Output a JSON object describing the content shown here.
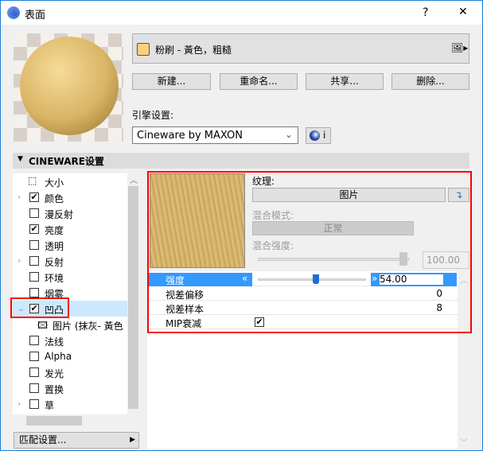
{
  "window": {
    "title": "表面",
    "help": "?",
    "close": "✕"
  },
  "material": {
    "name": "粉刷 - 黃色，粗糙",
    "swatch_color": "#fcd07f"
  },
  "buttons": {
    "new": "新建...",
    "rename": "重命名...",
    "share": "共享...",
    "delete": "删除..."
  },
  "engine": {
    "label": "引擎设置:",
    "value": "Cineware by MAXON",
    "info": "i"
  },
  "section": {
    "title": "CINEWARE设置"
  },
  "tree": [
    {
      "label": "大小",
      "type": "size",
      "checked": null,
      "expand": ""
    },
    {
      "label": "颜色",
      "checked": true,
      "expand": ">"
    },
    {
      "label": "漫反射",
      "checked": false,
      "expand": ""
    },
    {
      "label": "亮度",
      "checked": true,
      "expand": ""
    },
    {
      "label": "透明",
      "checked": false,
      "expand": ""
    },
    {
      "label": "反射",
      "checked": false,
      "expand": ">"
    },
    {
      "label": "环境",
      "checked": false,
      "expand": ""
    },
    {
      "label": "烟雾",
      "checked": false,
      "expand": ""
    },
    {
      "label": "凹凸",
      "checked": true,
      "expand": "v",
      "selected": true
    },
    {
      "label": "图片 (抹灰- 黃色",
      "type": "image",
      "checked": null,
      "expand": ""
    },
    {
      "label": "法线",
      "checked": false,
      "expand": ""
    },
    {
      "label": "Alpha",
      "checked": false,
      "expand": ""
    },
    {
      "label": "发光",
      "checked": false,
      "expand": ""
    },
    {
      "label": "置换",
      "checked": false,
      "expand": ""
    },
    {
      "label": "草",
      "checked": false,
      "expand": ">"
    }
  ],
  "match_settings": "匹配设置...",
  "texture": {
    "label": "纹理:",
    "value": "图片",
    "blend_mode_label": "混合模式:",
    "blend_mode": "正常",
    "blend_strength_label": "混合强度:",
    "blend_strength": "100.00",
    "blend_strength_pct": 100
  },
  "params": {
    "strength": {
      "label": "强度",
      "value": "54.00",
      "slider_pct": 54
    },
    "parallax_offset": {
      "label": "视差偏移",
      "value": "0"
    },
    "parallax_samples": {
      "label": "视差样本",
      "value": "8"
    },
    "mip": {
      "label": "MIP衰减",
      "checked": true
    }
  },
  "colors": {
    "accent": "#3399ff",
    "highlight": "#cce8ff",
    "red_box": "#ff0000"
  }
}
